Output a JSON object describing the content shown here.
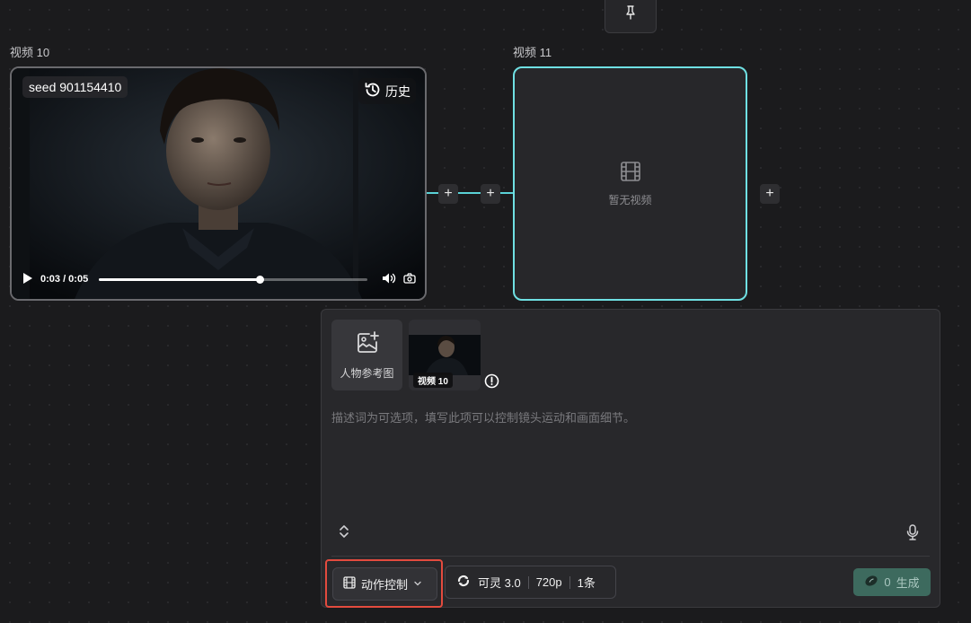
{
  "nodes": {
    "video10": {
      "label": "视频 10",
      "seed": "seed 901154410",
      "history_label": "历史",
      "time_display": "0:03 / 0:05",
      "progress": 0.6
    },
    "video11": {
      "label": "视频 11",
      "empty_text": "暂无视频"
    }
  },
  "panel": {
    "ref_tile_label": "人物参考图",
    "thumb_tag": "视频 10",
    "prompt_placeholder": "描述词为可选项，填写此项可以控制镜头运动和画面细节。",
    "mode_label": "动作控制",
    "model_name": "可灵 3.0",
    "resolution": "720p",
    "count": "1条",
    "generate_cost": "0",
    "generate_label": "生成"
  },
  "icons": [
    "pin-icon",
    "history-icon",
    "play-icon",
    "volume-icon",
    "camera-icon",
    "plus-icon",
    "film-icon",
    "image-add-icon",
    "warning-icon",
    "expand-icon",
    "mic-icon",
    "chevron-down-icon",
    "model-logo-icon",
    "credit-icon"
  ],
  "colors": {
    "accent_cyan": "#6fe0e3",
    "highlight_red": "#e34b3e",
    "generate_bg": "#3d6a5e"
  }
}
